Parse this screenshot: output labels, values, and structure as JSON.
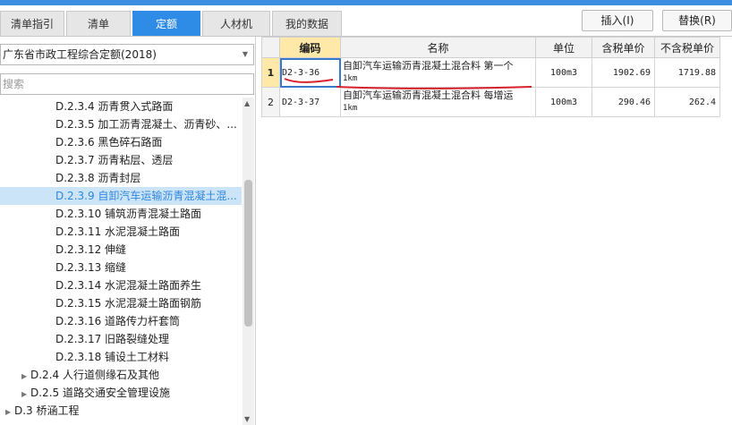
{
  "tabs": [
    {
      "label": "清单指引",
      "active": false
    },
    {
      "label": "清单",
      "active": false
    },
    {
      "label": "定额",
      "active": true
    },
    {
      "label": "人材机",
      "active": false
    },
    {
      "label": "我的数据",
      "active": false
    }
  ],
  "toolbar": {
    "insert_label": "插入(I)",
    "replace_label": "替换(R)"
  },
  "left": {
    "library_value": "广东省市政工程综合定额(2018)",
    "search_placeholder": "搜索",
    "tree": [
      {
        "label": "D.2.3.4 沥青贯入式路面",
        "selected": false,
        "expander": ""
      },
      {
        "label": "D.2.3.5 加工沥青混凝土、沥青砂、...",
        "selected": false,
        "expander": ""
      },
      {
        "label": "D.2.3.6 黑色碎石路面",
        "selected": false,
        "expander": ""
      },
      {
        "label": "D.2.3.7 沥青粘层、透层",
        "selected": false,
        "expander": ""
      },
      {
        "label": "D.2.3.8 沥青封层",
        "selected": false,
        "expander": ""
      },
      {
        "label": "D.2.3.9 自卸汽车运输沥青混凝土混...",
        "selected": true,
        "expander": ""
      },
      {
        "label": "D.2.3.10 铺筑沥青混凝土路面",
        "selected": false,
        "expander": ""
      },
      {
        "label": "D.2.3.11 水泥混凝土路面",
        "selected": false,
        "expander": ""
      },
      {
        "label": "D.2.3.12 伸缝",
        "selected": false,
        "expander": ""
      },
      {
        "label": "D.2.3.13 缩缝",
        "selected": false,
        "expander": ""
      },
      {
        "label": "D.2.3.14 水泥混凝土路面养生",
        "selected": false,
        "expander": ""
      },
      {
        "label": "D.2.3.15 水泥混凝土路面钢筋",
        "selected": false,
        "expander": ""
      },
      {
        "label": "D.2.3.16 道路传力杆套筒",
        "selected": false,
        "expander": ""
      },
      {
        "label": "D.2.3.17 旧路裂缝处理",
        "selected": false,
        "expander": ""
      },
      {
        "label": "D.2.3.18 铺设土工材料",
        "selected": false,
        "expander": ""
      },
      {
        "label": "D.2.4 人行道侧缘石及其他",
        "selected": false,
        "expander": "▶"
      },
      {
        "label": "D.2.5 道路交通安全管理设施",
        "selected": false,
        "expander": "▶"
      },
      {
        "label": "D.3 桥涵工程",
        "selected": false,
        "expander": "▶"
      }
    ]
  },
  "grid": {
    "headers": [
      "",
      "编码",
      "名称",
      "单位",
      "含税单价",
      "不含税单价"
    ],
    "rows": [
      {
        "index": "1",
        "code": "D2-3-36",
        "name": "自卸汽车运输沥青混凝土混合料 第一个",
        "name_sub": "1km",
        "unit": "100m3",
        "price_tax": "1902.69",
        "price_notax": "1719.88",
        "selected": true
      },
      {
        "index": "2",
        "code": "D2-3-37",
        "name": "自卸汽车运输沥青混凝土混合料 每增运",
        "name_sub": "1km",
        "unit": "100m3",
        "price_tax": "290.46",
        "price_notax": "262.4",
        "selected": false
      }
    ]
  },
  "colors": {
    "accent": "#2f8ce6",
    "annotation": "#d6202a",
    "header_highlight": "#ffe9a8"
  },
  "icons": {
    "dropdown": "chevron-down-icon",
    "scroll_up": "arrow-up-icon",
    "scroll_down": "arrow-down-icon",
    "expander": "triangle-right-icon"
  }
}
